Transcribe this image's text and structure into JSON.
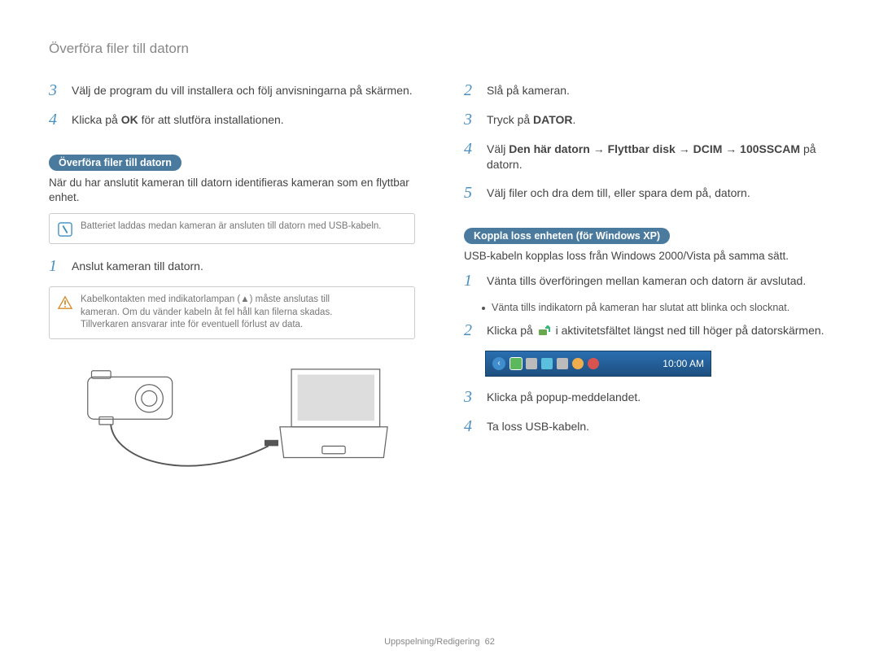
{
  "page_title": "Överföra filer till datorn",
  "left": {
    "steps_top": [
      {
        "num": "3",
        "text": "Välj de program du vill installera och följ anvisningarna på skärmen."
      },
      {
        "num": "4",
        "text_pre": "Klicka på ",
        "bold": "OK",
        "text_post": " för att slutföra installationen."
      }
    ],
    "sub_label": "Överföra filer till datorn",
    "intro": "När du har anslutit kameran till datorn identifieras kameran som en flyttbar enhet.",
    "note_info": "Batteriet laddas medan kameran är ansluten till datorn med USB-kabeln.",
    "step_connect": {
      "num": "1",
      "text": "Anslut kameran till datorn."
    },
    "note_warn_lines": [
      "Kabelkontakten med indikatorlampan (▲) måste anslutas till",
      "kameran. Om du vänder kabeln åt fel håll kan filerna skadas.",
      "Tillverkaren ansvarar inte för eventuell förlust av data."
    ]
  },
  "right": {
    "steps_top": [
      {
        "num": "2",
        "text": "Slå på kameran."
      },
      {
        "num": "3",
        "text_pre": "Tryck på ",
        "bold": "DATOR",
        "text_post": "."
      },
      {
        "num": "4",
        "text_pre": "Välj ",
        "bold": "Den här datorn → Flyttbar disk → DCIM → 100SSCAM",
        "text_post": " på datorn."
      },
      {
        "num": "5",
        "text": "Välj filer och dra dem till, eller spara dem på, datorn."
      }
    ],
    "sub_label": "Koppla loss enheten (för Windows XP)",
    "intro": "USB-kabeln kopplas loss från Windows 2000/Vista på samma sätt.",
    "steps_bottom": [
      {
        "num": "1",
        "text": "Vänta tills överföringen mellan kameran och datorn är avslutad."
      },
      {
        "bullet": "Vänta tills indikatorn på kameran har slutat att blinka och slocknat."
      },
      {
        "num": "2",
        "text_pre": "Klicka på ",
        "icon": "safely-remove-icon",
        "text_post": " i aktivitetsfältet längst ned till höger på datorskärmen."
      },
      {
        "systray": true
      },
      {
        "num": "3",
        "text": "Klicka på popup-meddelandet."
      },
      {
        "num": "4",
        "text": "Ta loss USB-kabeln."
      }
    ],
    "systray_clock": "10:00 AM"
  },
  "footer": {
    "section": "Uppspelning/Redigering",
    "page": "62"
  }
}
